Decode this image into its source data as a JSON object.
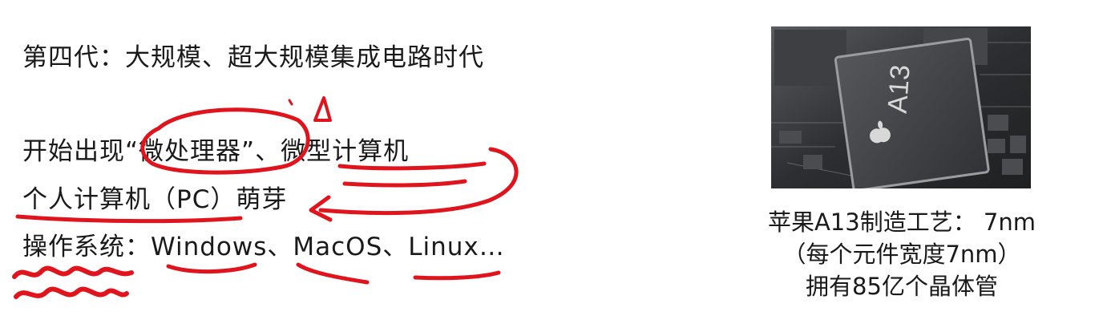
{
  "slide": {
    "heading": "第四代：大规模、超大规模集成电路时代",
    "line_microprocessor": "开始出现“微处理器”、微型计算机",
    "line_pc": "个人计算机（PC）萌芽",
    "line_os": "操作系统：Windows、MacOS、Linux…"
  },
  "figure": {
    "chip_marking": "A13",
    "caption_line1": "苹果A13制造工艺： 7nm",
    "caption_line2": "（每个元件宽度7nm）",
    "caption_line3": "拥有85亿个晶体管"
  },
  "colors": {
    "annotation_ink": "#e0141c",
    "text": "#1a1a1a",
    "chip_body": "#3a3c40",
    "board": "#2b2d30"
  }
}
